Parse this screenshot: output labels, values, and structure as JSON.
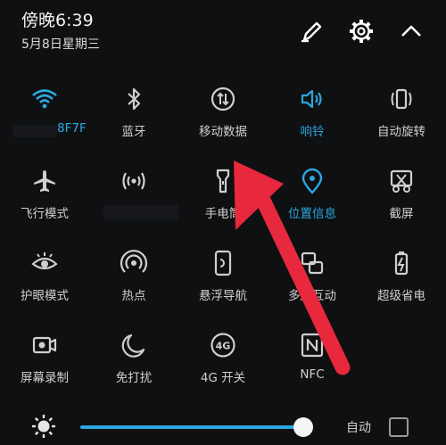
{
  "header": {
    "time": "傍晚6:39",
    "date": "5月8日星期三"
  },
  "tiles": [
    {
      "label": "8F7F",
      "active": true,
      "icon": "wifi-icon"
    },
    {
      "label": "蓝牙",
      "active": false,
      "icon": "bluetooth-icon"
    },
    {
      "label": "移动数据",
      "active": false,
      "icon": "mobile-data-icon"
    },
    {
      "label": "响铃",
      "active": true,
      "icon": "ring-icon"
    },
    {
      "label": "自动旋转",
      "active": false,
      "icon": "auto-rotate-icon"
    },
    {
      "label": "飞行模式",
      "active": false,
      "icon": "airplane-icon"
    },
    {
      "label": "",
      "active": false,
      "icon": "hotspot-icon"
    },
    {
      "label": "手电筒",
      "active": false,
      "icon": "flashlight-icon"
    },
    {
      "label": "位置信息",
      "active": true,
      "icon": "location-icon"
    },
    {
      "label": "截屏",
      "active": false,
      "icon": "screenshot-icon"
    },
    {
      "label": "护眼模式",
      "active": false,
      "icon": "eye-icon"
    },
    {
      "label": "热点",
      "active": false,
      "icon": "hotspot-ring-icon"
    },
    {
      "label": "悬浮导航",
      "active": false,
      "icon": "floating-nav-icon"
    },
    {
      "label": "多屏互动",
      "active": false,
      "icon": "multiscreen-icon"
    },
    {
      "label": "超级省电",
      "active": false,
      "icon": "battery-saver-icon"
    },
    {
      "label": "屏幕录制",
      "active": false,
      "icon": "screen-record-icon"
    },
    {
      "label": "免打扰",
      "active": false,
      "icon": "moon-icon"
    },
    {
      "label": "4G 开关",
      "active": false,
      "icon": "4g-icon"
    },
    {
      "label": "NFC",
      "active": false,
      "icon": "nfc-icon"
    }
  ],
  "brightness": {
    "level": 0.9,
    "auto_label": "自动",
    "auto_checked": false
  },
  "colors": {
    "accent": "#2ba7e0",
    "arrow": "#e8283c",
    "icon": "#cfcfcf"
  }
}
